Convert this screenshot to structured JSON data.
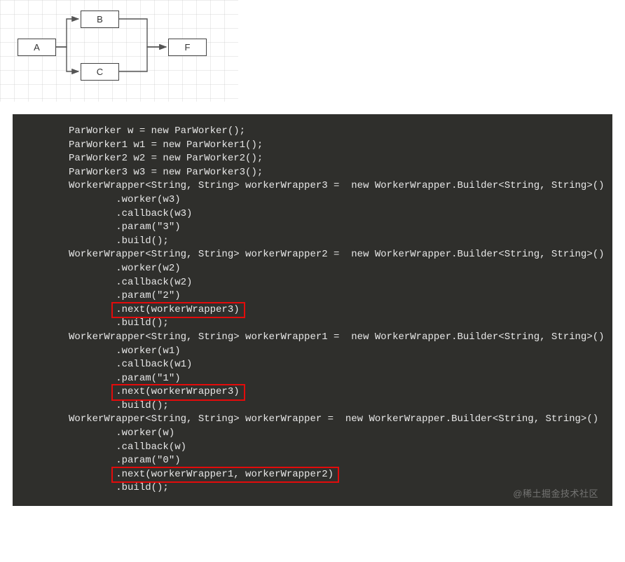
{
  "diagram": {
    "nodes": {
      "A": "A",
      "B": "B",
      "C": "C",
      "F": "F"
    }
  },
  "code": {
    "l1": "ParWorker w = new ParWorker();",
    "l2": "ParWorker1 w1 = new ParWorker1();",
    "l3": "ParWorker2 w2 = new ParWorker2();",
    "l4": "ParWorker3 w3 = new ParWorker3();",
    "l5": "",
    "l6": "WorkerWrapper<String, String> workerWrapper3 =  new WorkerWrapper.Builder<String, String>()",
    "l7": "        .worker(w3)",
    "l8": "        .callback(w3)",
    "l9": "        .param(\"3\")",
    "l10": "        .build();",
    "l11": "",
    "l12": "WorkerWrapper<String, String> workerWrapper2 =  new WorkerWrapper.Builder<String, String>()",
    "l13": "        .worker(w2)",
    "l14": "        .callback(w2)",
    "l15": "        .param(\"2\")",
    "l16": "        .next(workerWrapper3)",
    "l17": "        .build();",
    "l18": "",
    "l19": "WorkerWrapper<String, String> workerWrapper1 =  new WorkerWrapper.Builder<String, String>()",
    "l20": "        .worker(w1)",
    "l21": "        .callback(w1)",
    "l22": "        .param(\"1\")",
    "l23": "        .next(workerWrapper3)",
    "l24": "        .build();",
    "l25": "",
    "l26": "WorkerWrapper<String, String> workerWrapper =  new WorkerWrapper.Builder<String, String>()",
    "l27": "        .worker(w)",
    "l28": "        .callback(w)",
    "l29": "        .param(\"0\")",
    "l30": "        .next(workerWrapper1, workerWrapper2)",
    "l31": "        .build();"
  },
  "watermark": "@稀土掘金技术社区"
}
